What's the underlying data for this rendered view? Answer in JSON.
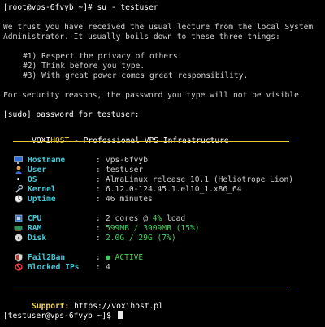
{
  "session": {
    "line1": "[root@vps-6fvyb ~]# su - testuser",
    "lecture_1": "We trust you have received the usual lecture from the local System",
    "lecture_2": "Administrator. It usually boils down to these three things:",
    "rule_1": "#1) Respect the privacy of others.",
    "rule_2": "#2) Think before you type.",
    "rule_3": "#3) With great power comes great responsibility.",
    "security": "For security reasons, the password you type will not be visible.",
    "sudo_prompt": "[sudo] password for testuser:"
  },
  "banner": {
    "brand_a": "VOXI",
    "brand_b": "HOST",
    "tagline": " - Professional VPS Infrastructure",
    "support_label": "Support:",
    "support_url": " https://voxihost.pl"
  },
  "info_rows": [
    {
      "icon": "monitor-icon",
      "label": "Hostname",
      "value": "vps-6fvyb"
    },
    {
      "icon": "user-icon",
      "label": "User",
      "value": "testuser"
    },
    {
      "icon": "os-icon",
      "label": "OS",
      "value": "AlmaLinux release 10.1 (Heliotrope Lion)"
    },
    {
      "icon": "wrench-icon",
      "label": "Kernel",
      "value": "6.12.0-124.45.1.el10_1.x86_64"
    },
    {
      "icon": "clock-icon",
      "label": "Uptime",
      "value": "46 minutes"
    }
  ],
  "resources": {
    "cpu_label": "CPU",
    "cpu_prefix": "2 cores @ ",
    "cpu_pct": "4%",
    "cpu_suffix": " load",
    "ram_label": "RAM",
    "ram_value": "599MB / 3909MB (15%)",
    "disk_label": "Disk",
    "disk_value": "2.0G / 29G (7%)"
  },
  "security_rows": {
    "fail2ban_label": "Fail2Ban",
    "fail2ban_value": "● ACTIVE",
    "blocked_label": "Blocked IPs",
    "blocked_value": "4"
  },
  "prompt": "[testuser@vps-6fvyb ~]$ ",
  "colors": {
    "cyan": "#3fc8d8",
    "yellow": "#f0d44a",
    "green": "#42d15a"
  }
}
